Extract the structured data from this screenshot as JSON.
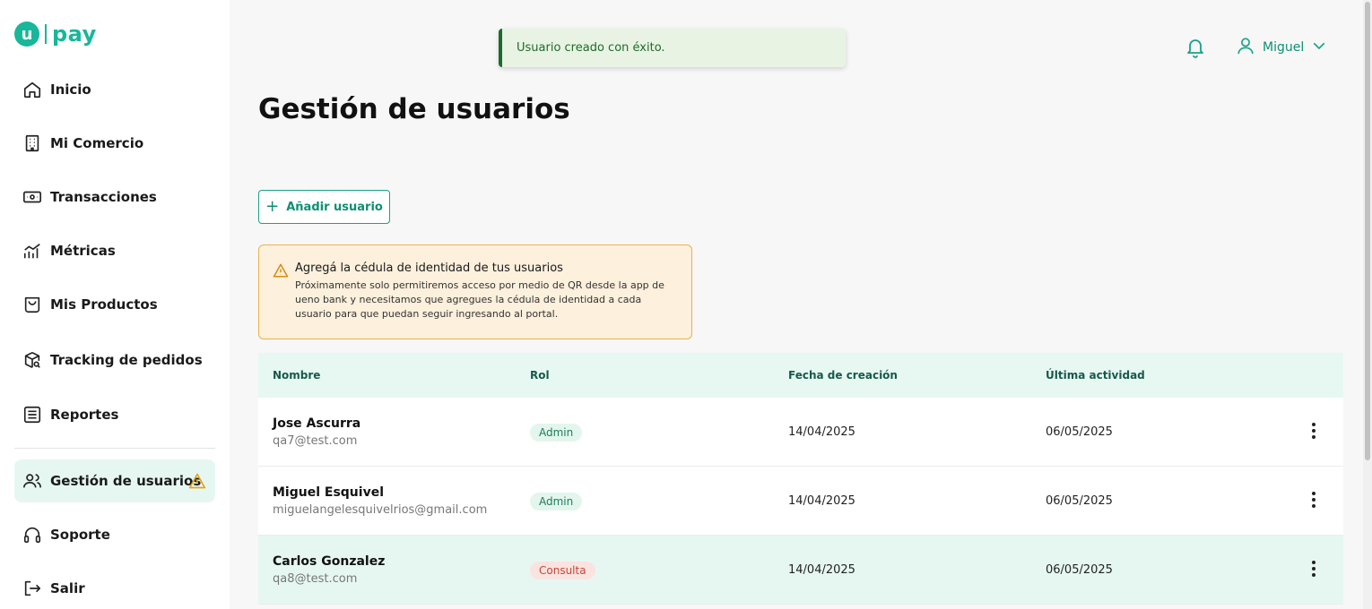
{
  "brand": {
    "badge": "u",
    "name": "pay",
    "color": "#18b79a"
  },
  "sidebar": {
    "items": [
      {
        "label": "Inicio",
        "icon": "home-icon"
      },
      {
        "label": "Mi Comercio",
        "icon": "building-icon"
      },
      {
        "label": "Transacciones",
        "icon": "cash-icon"
      },
      {
        "label": "Métricas",
        "icon": "chart-icon"
      },
      {
        "label": "Mis Productos",
        "icon": "bag-icon"
      },
      {
        "label": "Tracking de pedidos",
        "icon": "package-search-icon"
      },
      {
        "label": "Reportes",
        "icon": "document-list-icon"
      },
      {
        "label": "Gestión de usuarios",
        "icon": "users-icon",
        "active": true,
        "warning": true
      },
      {
        "label": "Soporte",
        "icon": "headset-icon"
      },
      {
        "label": "Salir",
        "icon": "logout-icon"
      }
    ]
  },
  "toast": {
    "message": "Usuario creado con éxito."
  },
  "header": {
    "user_name": "Miguel"
  },
  "page": {
    "title": "Gestión de usuarios",
    "add_button": "Añadir usuario"
  },
  "alert": {
    "title": "Agregá la cédula de identidad de tus usuarios",
    "text": "Próximamente solo permitiremos acceso por medio de QR desde la app de ueno bank y necesitamos que agregues la cédula de identidad a cada usuario para que puedan seguir ingresando al portal."
  },
  "table": {
    "headers": [
      "Nombre",
      "Rol",
      "Fecha de creación",
      "Última actividad"
    ],
    "rows": [
      {
        "name": "Jose Ascurra",
        "email": "qa7@test.com",
        "role": "Admin",
        "created": "14/04/2025",
        "last": "06/05/2025"
      },
      {
        "name": "Miguel Esquivel",
        "email": "miguelangelesquivelrios@gmail.com",
        "role": "Admin",
        "created": "14/04/2025",
        "last": "06/05/2025"
      },
      {
        "name": "Carlos Gonzalez",
        "email": "qa8@test.com",
        "role": "Consulta",
        "created": "14/04/2025",
        "last": "06/05/2025"
      }
    ]
  }
}
